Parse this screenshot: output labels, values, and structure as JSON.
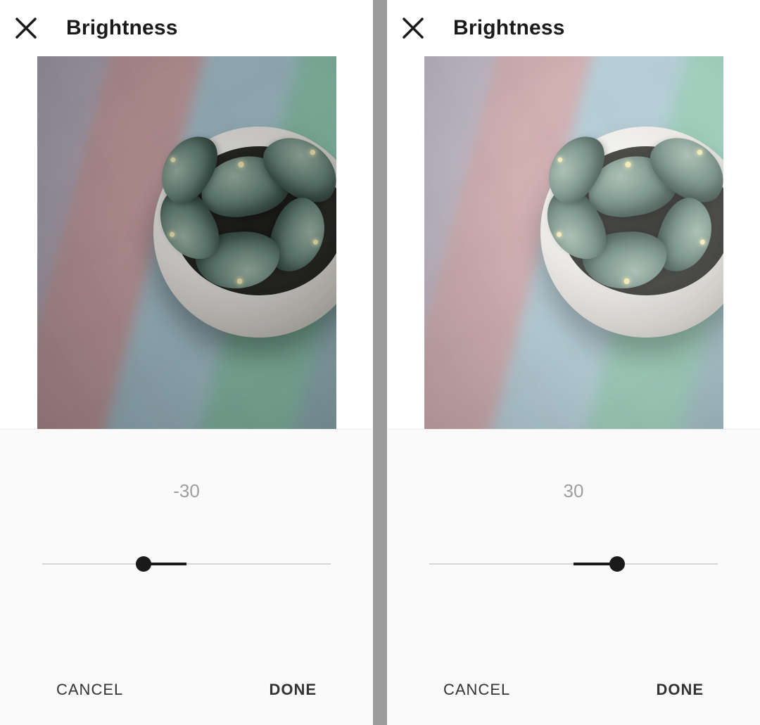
{
  "slider": {
    "min": -100,
    "max": 100
  },
  "panels": [
    {
      "title": "Brightness",
      "value": -30,
      "value_label": "-30",
      "cancel_label": "CANCEL",
      "done_label": "DONE"
    },
    {
      "title": "Brightness",
      "value": 30,
      "value_label": "30",
      "cancel_label": "CANCEL",
      "done_label": "DONE"
    }
  ]
}
